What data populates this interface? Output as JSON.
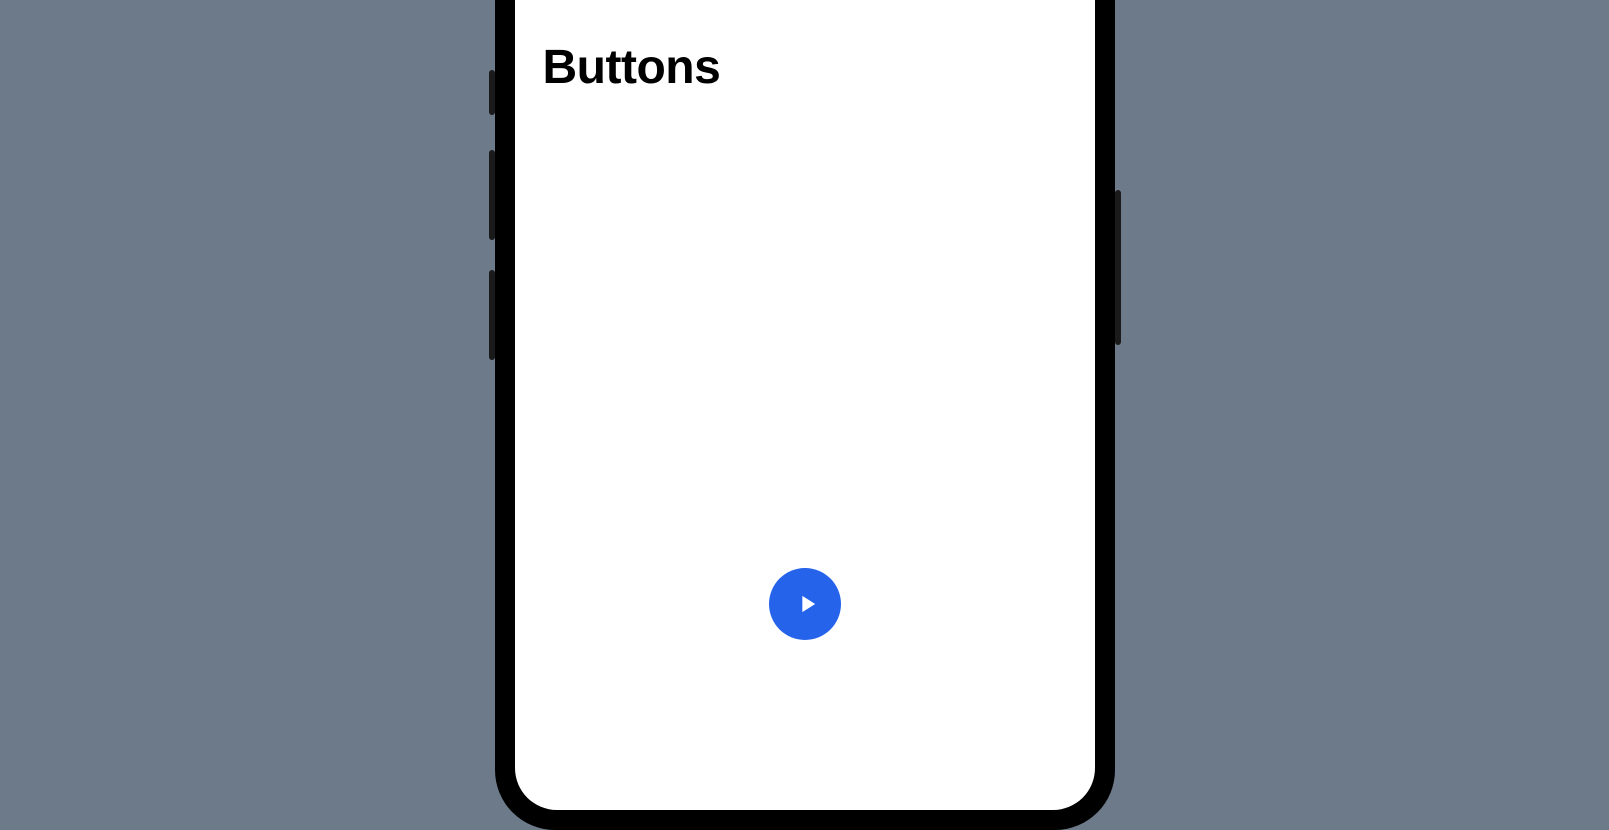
{
  "header": {
    "title": "Buttons"
  },
  "main": {
    "playButton": {
      "iconName": "play-icon",
      "accentColor": "#2563eb"
    }
  }
}
